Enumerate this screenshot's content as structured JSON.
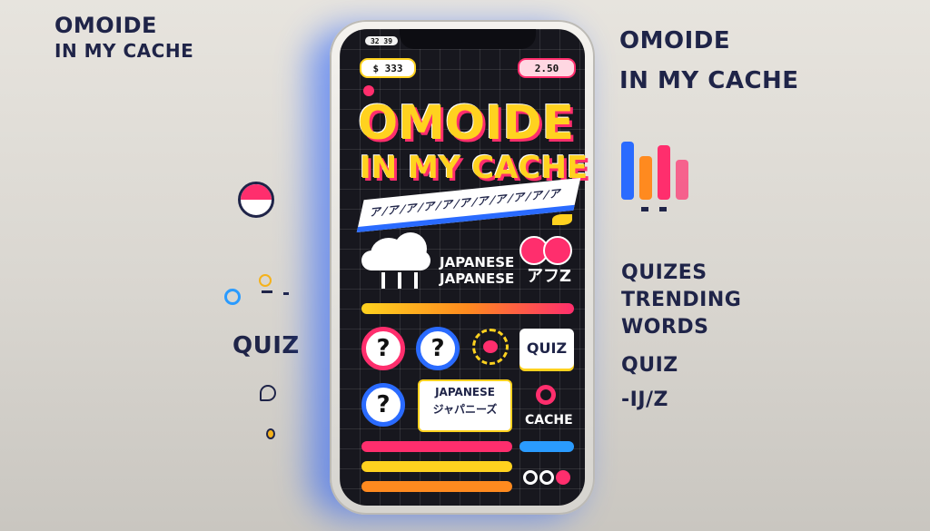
{
  "left": {
    "title_line1": "OMOIDE",
    "title_line2": "IN MY CACHE",
    "quiz_label": "QUIZ"
  },
  "right": {
    "title_line1": "OMOIDE",
    "title_line2": "IN MY CACHE",
    "items": [
      "QUIZES",
      "TRENDING",
      "WORDS",
      "QUIZ",
      "-IJ/Z"
    ]
  },
  "phone": {
    "status_left": "$ 333",
    "status_right": "2.50",
    "status_tiny": "32 39",
    "title_line1": "OMOIDE",
    "title_line2": "IN MY CACHE",
    "subtitle_strip": "ア/ア/ア/ア/ア/ア/ア/ア/ア/ア/ア",
    "japanese_line1": "JAPANESE",
    "japanese_line2": "JAPANESE",
    "japanese_suffix": "アフZ",
    "quiz_button": "QUIZ",
    "card_japanese": "JAPANESE",
    "card_sub": "ジャパニーズ",
    "cache_label": "CACHE",
    "question_mark": "?"
  },
  "colors": {
    "accent_yellow": "#ffd21f",
    "accent_pink": "#ff2e6d",
    "accent_blue": "#2a6bff",
    "accent_orange": "#ff8a1f",
    "label_navy": "#1f2448"
  }
}
